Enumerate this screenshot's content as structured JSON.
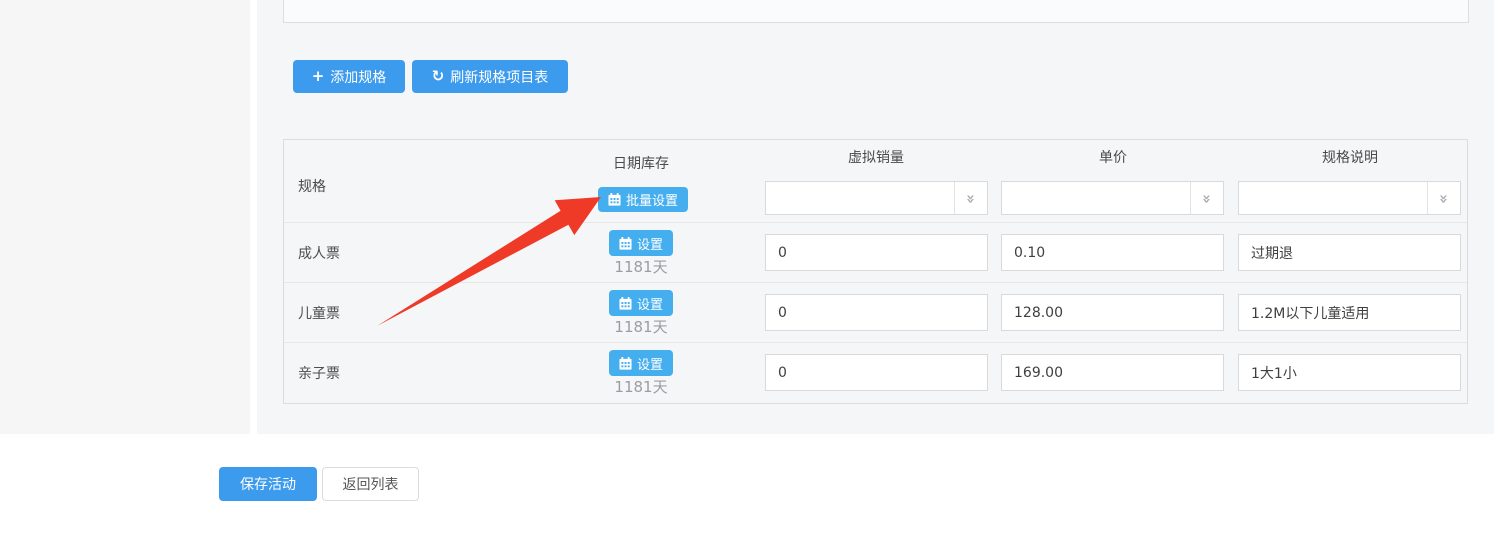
{
  "colors": {
    "primary_blue": "#3d9bed",
    "info_blue": "#45aeef",
    "arrow_red": "#ee3a27",
    "panel_gray": "#f5f6f7"
  },
  "icons": {
    "plus": "+",
    "refresh": "↻",
    "apply_down_chevron": "»",
    "calendar": "calendar-grid"
  },
  "toolbar": {
    "add_spec_label": "添加规格",
    "refresh_spec_label": "刷新规格项目表"
  },
  "spec_table": {
    "col_spec": "规格",
    "col_date_stock": "日期库存",
    "col_virtual_sales": "虚拟销量",
    "col_unit_price": "单价",
    "col_spec_desc": "规格说明",
    "batch_set_label": "批量设置",
    "set_label": "设置",
    "header_inputs": {
      "virtual_sales_value": "",
      "unit_price_value": "",
      "spec_desc_value": ""
    },
    "rows": [
      {
        "name": "成人票",
        "stock_days": "1181天",
        "virtual_sales": "0",
        "unit_price": "0.10",
        "desc": "过期退"
      },
      {
        "name": "儿童票",
        "stock_days": "1181天",
        "virtual_sales": "0",
        "unit_price": "128.00",
        "desc": "1.2M以下儿童适用"
      },
      {
        "name": "亲子票",
        "stock_days": "1181天",
        "virtual_sales": "0",
        "unit_price": "169.00",
        "desc": "1大1小"
      }
    ]
  },
  "footer": {
    "save_label": "保存活动",
    "back_label": "返回列表"
  }
}
